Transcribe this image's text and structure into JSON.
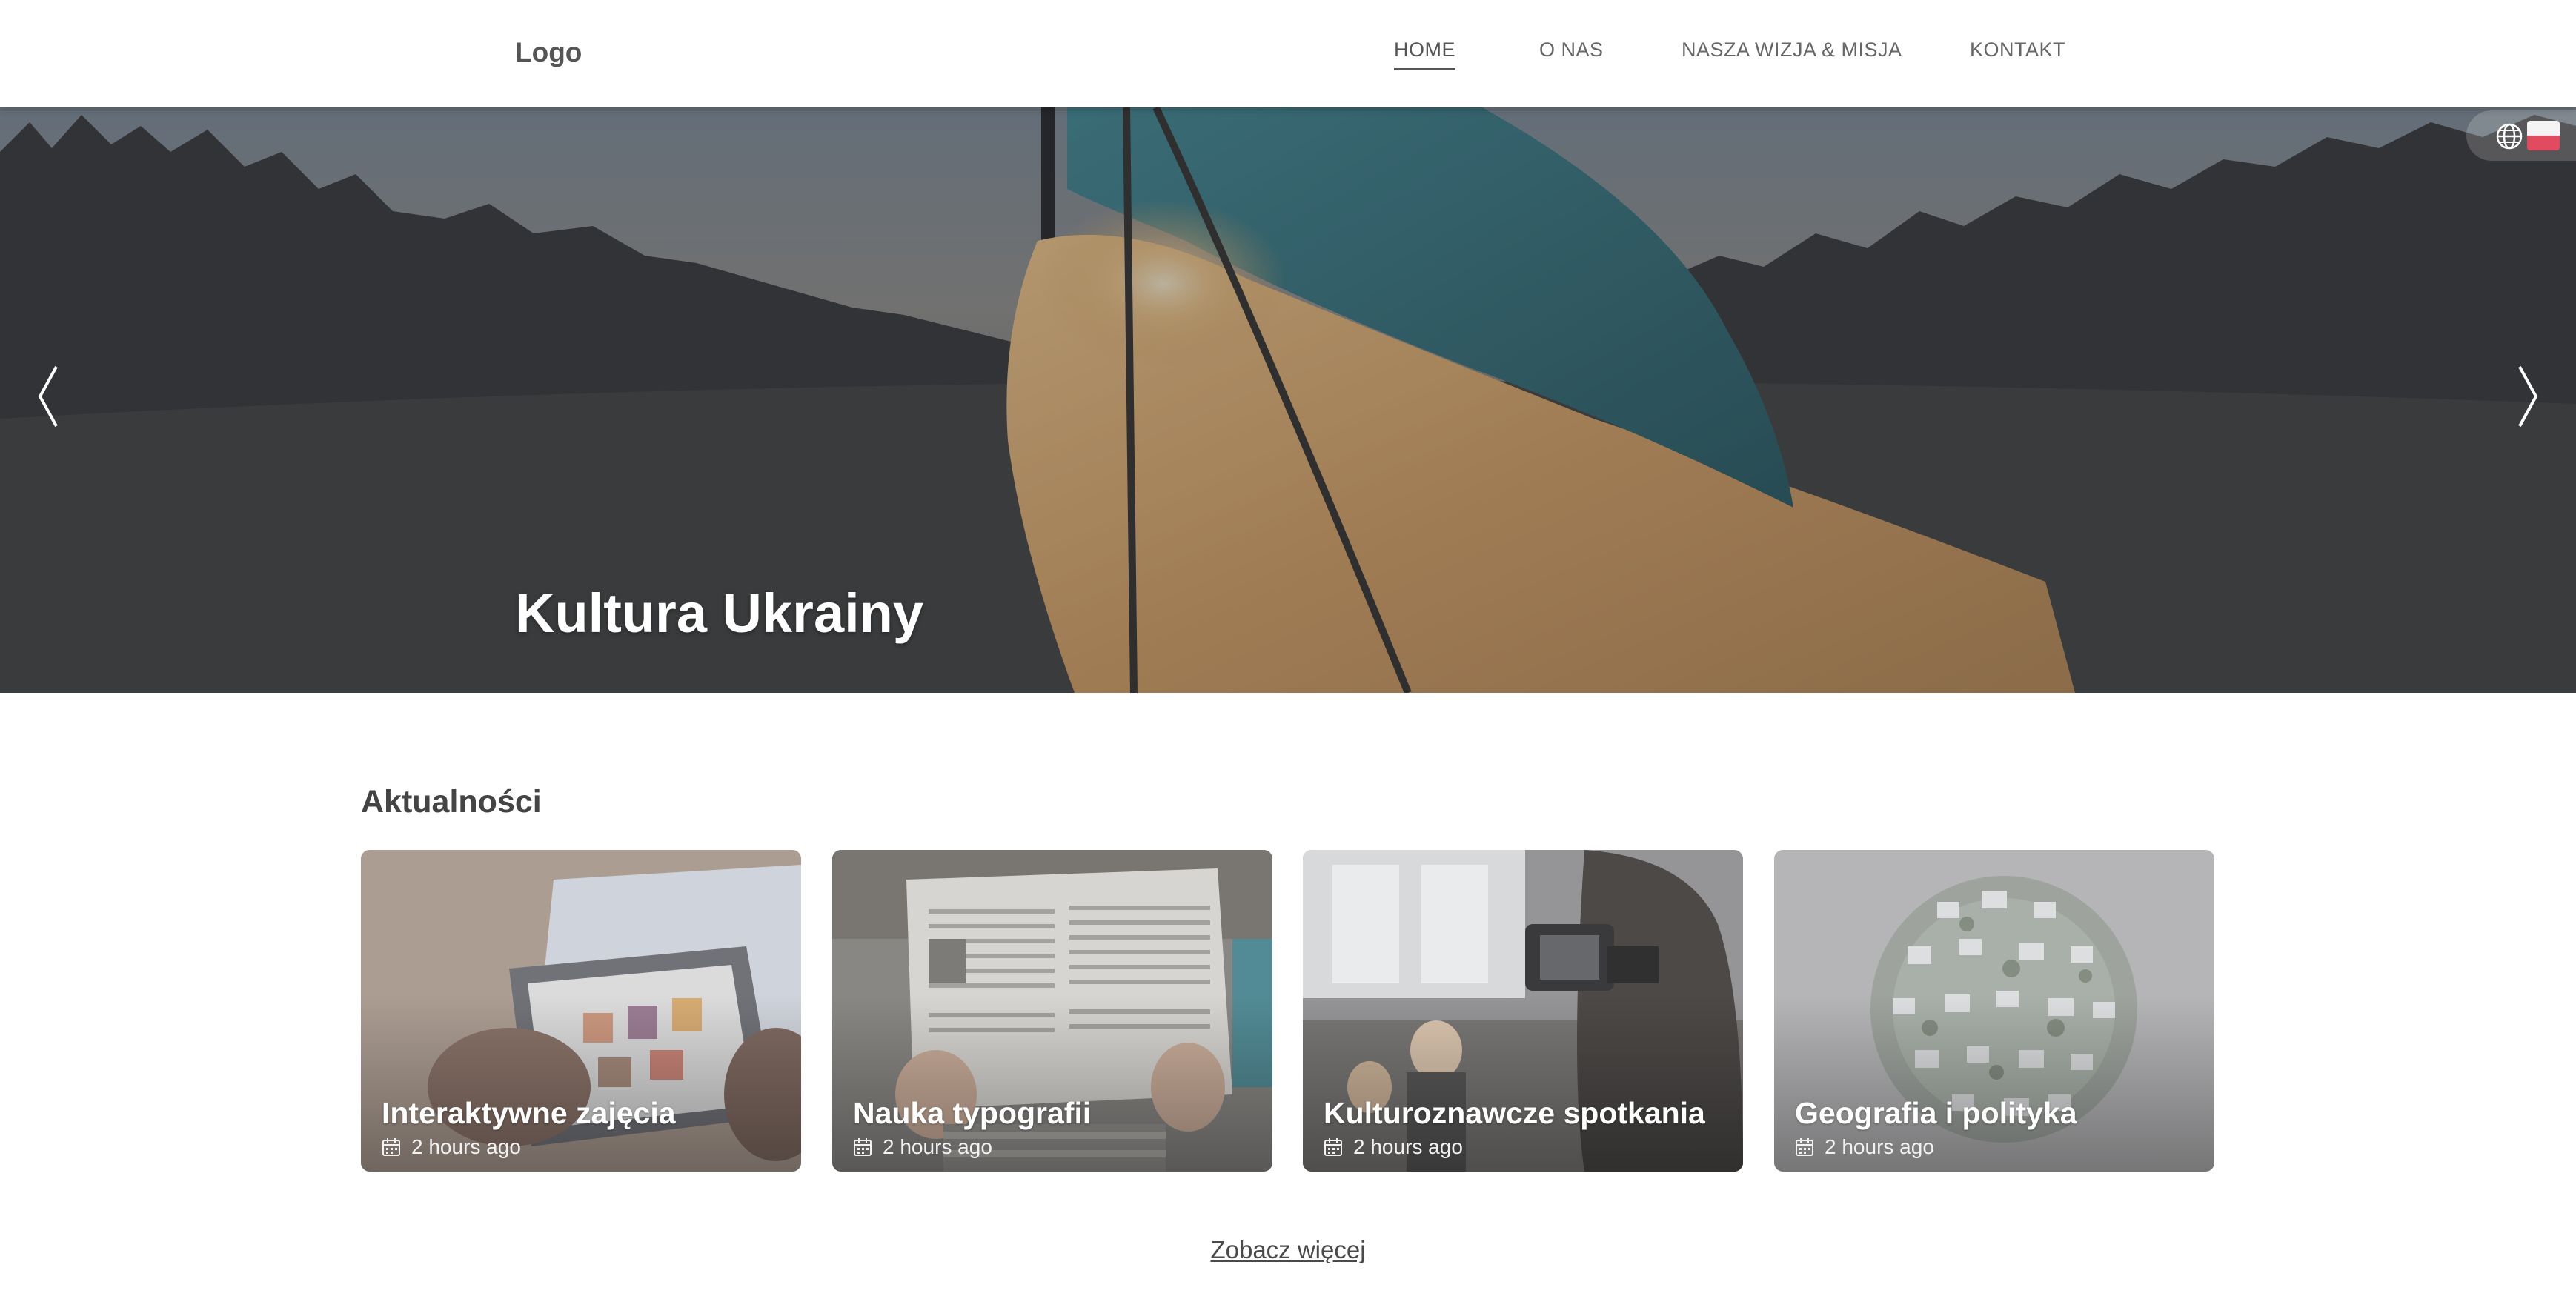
{
  "header": {
    "logo": "Logo",
    "nav": [
      {
        "label": "HOME",
        "active": true
      },
      {
        "label": "O NAS",
        "active": false
      },
      {
        "label": "NASZA WIZJA & MISJA",
        "active": false
      },
      {
        "label": "KONTAKT",
        "active": false
      }
    ]
  },
  "hero": {
    "title": "Kultura Ukrainy",
    "prev_icon": "chevron-left-icon",
    "next_icon": "chevron-right-icon",
    "language": {
      "icon": "globe-icon",
      "flag": "pl-flag"
    }
  },
  "news": {
    "title": "Aktualności",
    "cards": [
      {
        "title": "Interaktywne zajęcia",
        "time": "2 hours ago"
      },
      {
        "title": "Nauka typografii",
        "time": "2 hours ago"
      },
      {
        "title": "Kulturoznawcze spotkania",
        "time": "2 hours ago"
      },
      {
        "title": "Geografia i polityka",
        "time": "2 hours ago"
      }
    ],
    "see_more": "Zobacz więcej"
  },
  "colors": {
    "flag_blue": "#2f6e78",
    "flag_yellow": "#d9a35e",
    "overlay": "#4b4b4d"
  }
}
